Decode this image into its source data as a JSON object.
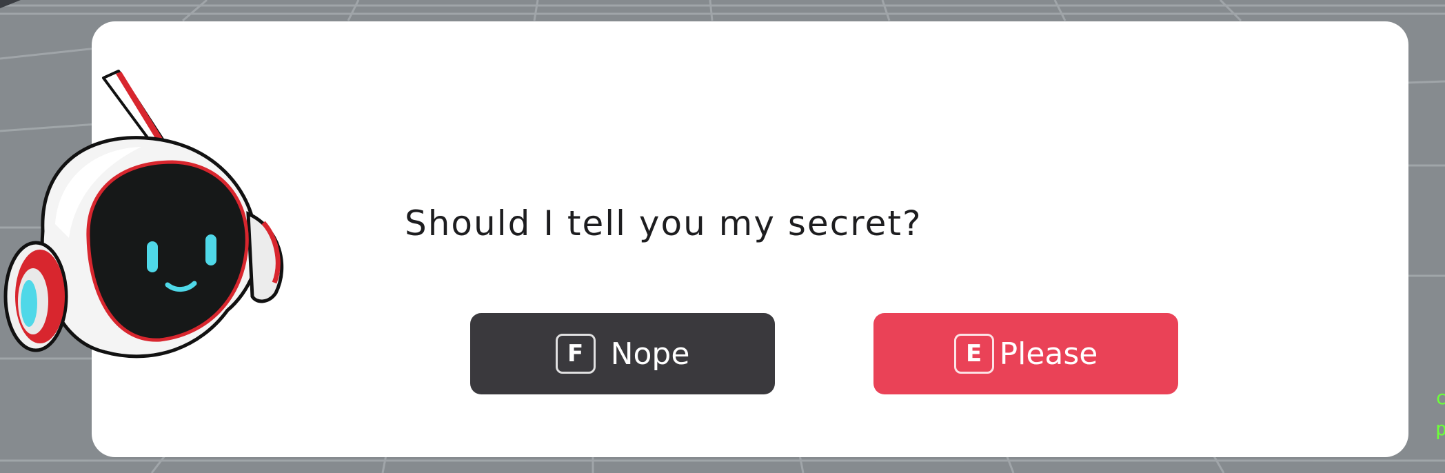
{
  "dialog": {
    "message": "Should I tell you my secret?",
    "choices": [
      {
        "key": "F",
        "label": "Nope"
      },
      {
        "key": "E",
        "label": "Please"
      }
    ]
  },
  "colors": {
    "panel": "#ffffff",
    "nope_button": "#3a393d",
    "please_button": "#ea4257",
    "robot_face": "#161818",
    "robot_eyes": "#4fd8e8",
    "robot_accent": "#d8262e",
    "floor": "#868b8f"
  },
  "icons": {
    "character": "robot-mascot-icon"
  }
}
